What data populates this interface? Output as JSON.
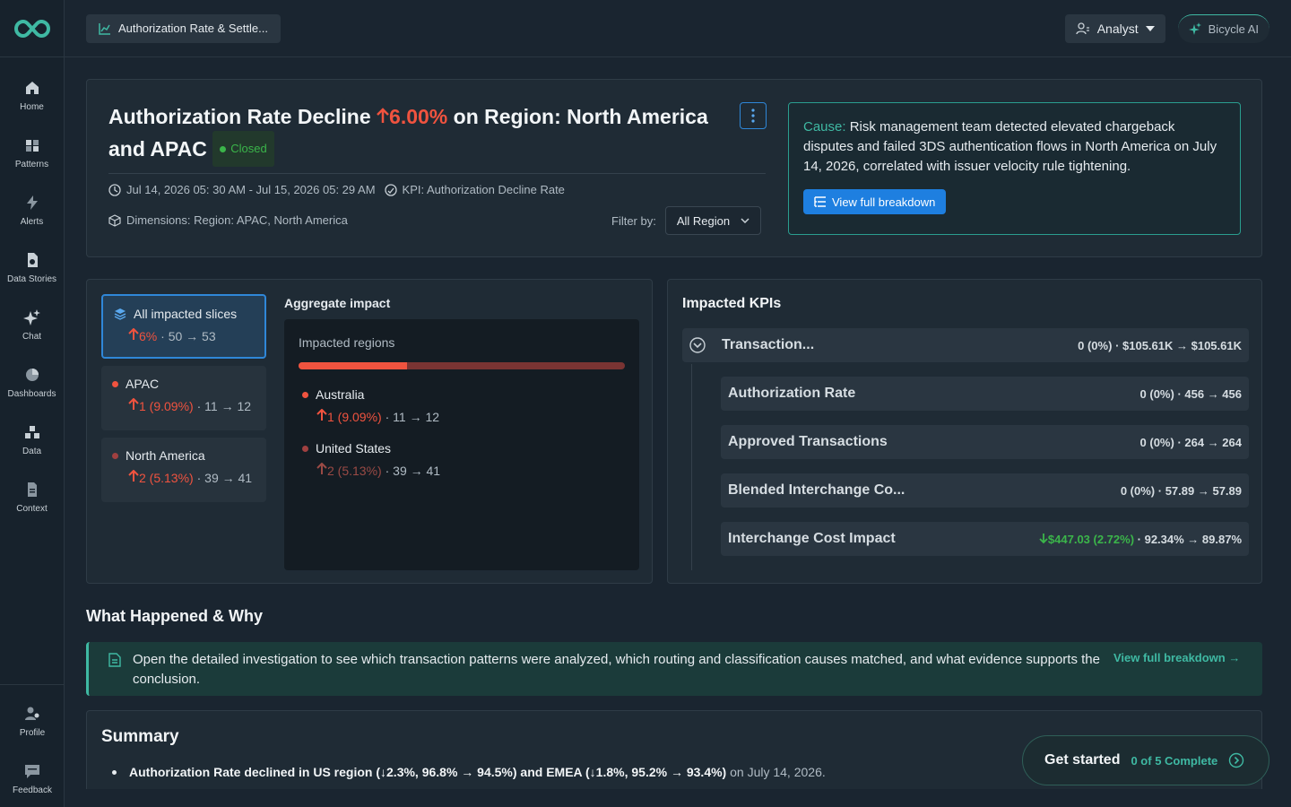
{
  "sidebar": {
    "items": [
      {
        "label": "Home"
      },
      {
        "label": "Patterns"
      },
      {
        "label": "Alerts"
      },
      {
        "label": "Data Stories"
      },
      {
        "label": "Chat"
      },
      {
        "label": "Dashboards"
      },
      {
        "label": "Data"
      },
      {
        "label": "Context"
      }
    ],
    "bottom": [
      {
        "label": "Profile"
      },
      {
        "label": "Feedback"
      }
    ]
  },
  "topbar": {
    "report_title": "Authorization Rate & Settle...",
    "role": "Analyst",
    "ai_label": "Bicycle AI"
  },
  "header": {
    "title_prefix": "Authorization Rate Decline",
    "title_change": "6.00%",
    "title_suffix": "on Region: North America",
    "title_line2": "and APAC",
    "status": "Closed",
    "time_range": "Jul 14, 2026 05: 30 AM - Jul 15, 2026 05: 29 AM",
    "kpi": "KPI: Authorization Decline Rate",
    "dimensions": "Dimensions: Region: APAC, North America",
    "filter_label": "Filter by:",
    "filter_value": "All Region",
    "cause_label": "Cause:",
    "cause_text": "Risk management team detected elevated chargeback disputes and failed 3DS authentication flows in North America on July 14, 2026, correlated with issuer velocity rule tightening.",
    "cause_button": "View full breakdown"
  },
  "slices": {
    "all": {
      "title": "All impacted slices",
      "change": "6%",
      "values": "50 → 53"
    },
    "apac": {
      "title": "APAC",
      "change": "1 (9.09%)",
      "values": "11 → 12"
    },
    "na": {
      "title": "North America",
      "change": "2 (5.13%)",
      "values": "39 → 41"
    }
  },
  "aggregate": {
    "title": "Aggregate impact",
    "regions_label": "Impacted regions",
    "bar_fraction": 0.333,
    "regions": [
      {
        "name": "Australia",
        "change": "1 (9.09%)",
        "values": "11 → 12"
      },
      {
        "name": "United States",
        "change": "2 (5.13%)",
        "values": "39 → 41"
      }
    ]
  },
  "kpis": {
    "title": "Impacted KPIs",
    "parent": {
      "name": "Transaction...",
      "delta": "0 (0%)",
      "values": "$105.61K → $105.61K"
    },
    "children": [
      {
        "name": "Authorization Rate",
        "delta": "0 (0%)",
        "values": "456 → 456"
      },
      {
        "name": "Approved Transactions",
        "delta": "0 (0%)",
        "values": "264 → 264"
      },
      {
        "name": "Blended Interchange Co...",
        "delta": "0 (0%)",
        "values": "57.89 → 57.89"
      },
      {
        "name": "Interchange Cost Impact",
        "delta": "$447.03 (2.72%)",
        "values": "92.34% → 89.87%"
      }
    ]
  },
  "what_happened": {
    "title": "What Happened & Why",
    "banner_text": "Open the detailed investigation to see which transaction patterns were analyzed, which routing and classification causes matched, and what evidence supports the conclusion.",
    "banner_link": "View full breakdown →"
  },
  "summary": {
    "title": "Summary",
    "bullet_bold": "Authorization Rate declined in US region (↓2.3%, 96.8% → 94.5%) and EMEA (↓1.8%, 95.2% → 93.4%)",
    "bullet_rest": " on July 14, 2026."
  },
  "get_started": {
    "label": "Get started",
    "progress": "0 of 5 Complete"
  },
  "colors": {
    "accent": "#3fb9a3",
    "red": "#f0533f",
    "green": "#3bb54a",
    "blue": "#1e7fe0"
  }
}
